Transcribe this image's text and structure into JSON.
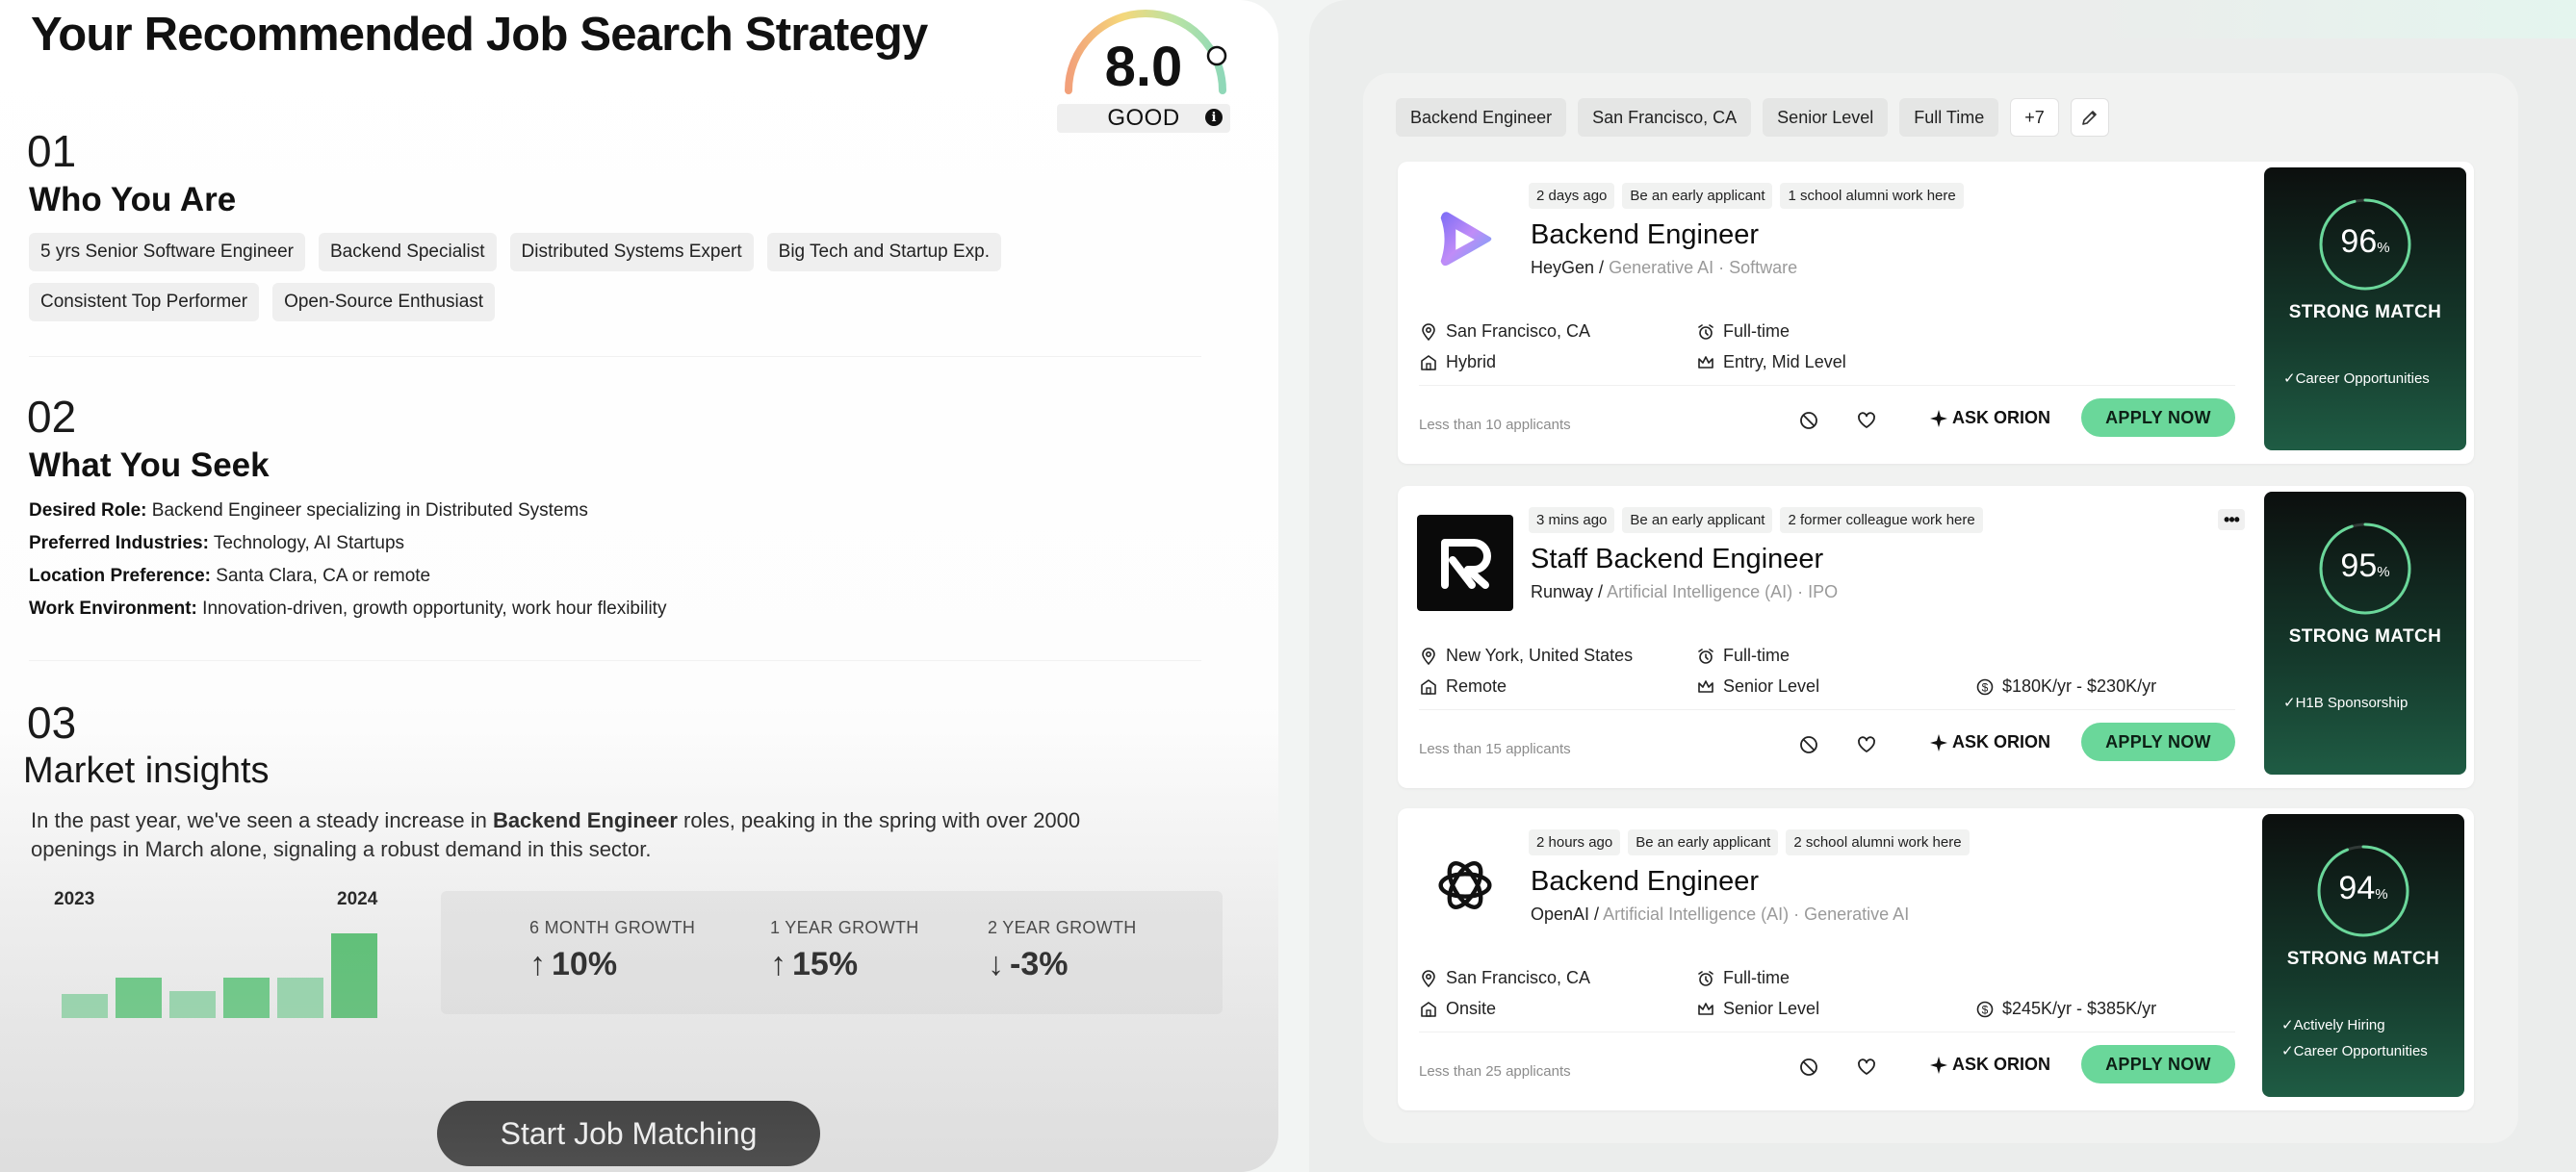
{
  "left": {
    "title": "Your Recommended Job Search Strategy",
    "score": {
      "value": "8.0",
      "label": "GOOD",
      "info": "i"
    },
    "section1": {
      "num": "01",
      "title": "Who You Are",
      "tags": [
        "5 yrs Senior Software Engineer",
        "Backend Specialist",
        "Distributed Systems Expert",
        "Big Tech and Startup Exp.",
        "Consistent Top Performer",
        "Open-Source Enthusiast"
      ]
    },
    "section2": {
      "num": "02",
      "title": "What You Seek",
      "items": [
        {
          "label": "Desired Role:",
          "value": "Backend Engineer specializing in Distributed Systems"
        },
        {
          "label": "Preferred Industries:",
          "value": "Technology, AI Startups"
        },
        {
          "label": "Location Preference:",
          "value": "Santa Clara, CA or remote"
        },
        {
          "label": "Work Environment:",
          "value": "Innovation-driven, growth opportunity, work hour flexibility"
        }
      ]
    },
    "section3": {
      "num": "03",
      "title": "Market insights",
      "text_before": "In the past year, we've seen a steady increase in ",
      "text_bold": "Backend Engineer",
      "text_after": " roles, peaking in the spring with over 2000 openings in March alone, signaling a robust demand in this sector.",
      "growth": [
        {
          "label": "6 MONTH GROWTH",
          "arrow": "↑",
          "value": "10%"
        },
        {
          "label": "1 YEAR GROWTH",
          "arrow": "↑",
          "value": "15%"
        },
        {
          "label": "2 YEAR GROWTH",
          "arrow": "↓",
          "value": "-3%"
        }
      ]
    },
    "start_button": "Start Job Matching"
  },
  "chart_data": {
    "type": "bar",
    "categories": [
      "1",
      "2",
      "3",
      "4",
      "5",
      "6"
    ],
    "values": [
      25,
      42,
      28,
      42,
      42,
      88
    ],
    "tick_labels": [
      "2023",
      "2024"
    ],
    "ylim": [
      0,
      100
    ],
    "colors": [
      "#8ed6a7",
      "#5cc87a",
      "#8ed6a7",
      "#5cc87a",
      "#8ed6a7",
      "#4dbf6a"
    ]
  },
  "filters": [
    "Backend Engineer",
    "San Francisco, CA",
    "Senior Level",
    "Full Time",
    "+7"
  ],
  "jobs": [
    {
      "badges": [
        "2 days ago",
        "Be an early applicant",
        "1 school alumni work here"
      ],
      "title": "Backend Engineer",
      "company": "HeyGen /",
      "sector": "Generative AI · Software",
      "location": "San Francisco, CA",
      "work_mode": "Hybrid",
      "job_type": "Full-time",
      "level": "Entry, Mid Level",
      "salary": "",
      "applicants": "Less than 10 applicants",
      "ask": "ASK ORION",
      "apply": "APPLY NOW",
      "match_value": "96",
      "match_pct": "%",
      "match_label": "STRONG MATCH",
      "match_fraction": 0.96,
      "notes": [
        "✓Career Opportunities"
      ]
    },
    {
      "badges": [
        "3 mins ago",
        "Be an early applicant",
        "2 former colleague work here"
      ],
      "title": "Staff Backend Engineer",
      "company": "Runway /",
      "sector": "Artificial Intelligence (AI) · IPO",
      "location": "New York, United States",
      "work_mode": "Remote",
      "job_type": "Full-time",
      "level": "Senior Level",
      "salary": "$180K/yr - $230K/yr",
      "applicants": "Less than 15 applicants",
      "ask": "ASK ORION",
      "apply": "APPLY NOW",
      "match_value": "95",
      "match_pct": "%",
      "match_label": "STRONG MATCH",
      "match_fraction": 0.95,
      "notes": [
        "✓H1B Sponsorship"
      ],
      "more": "•••"
    },
    {
      "badges": [
        "2 hours ago",
        "Be an early applicant",
        "2 school alumni work here"
      ],
      "title": "Backend Engineer",
      "company": "OpenAI /",
      "sector": "Artificial Intelligence (AI) · Generative AI",
      "location": "San Francisco, CA",
      "work_mode": "Onsite",
      "job_type": "Full-time",
      "level": "Senior Level",
      "salary": "$245K/yr - $385K/yr",
      "applicants": "Less than 25 applicants",
      "ask": "ASK ORION",
      "apply": "APPLY NOW",
      "match_value": "94",
      "match_pct": "%",
      "match_label": "STRONG MATCH",
      "match_fraction": 0.94,
      "notes": [
        "✓Actively Hiring",
        "✓Career Opportunities"
      ]
    }
  ]
}
